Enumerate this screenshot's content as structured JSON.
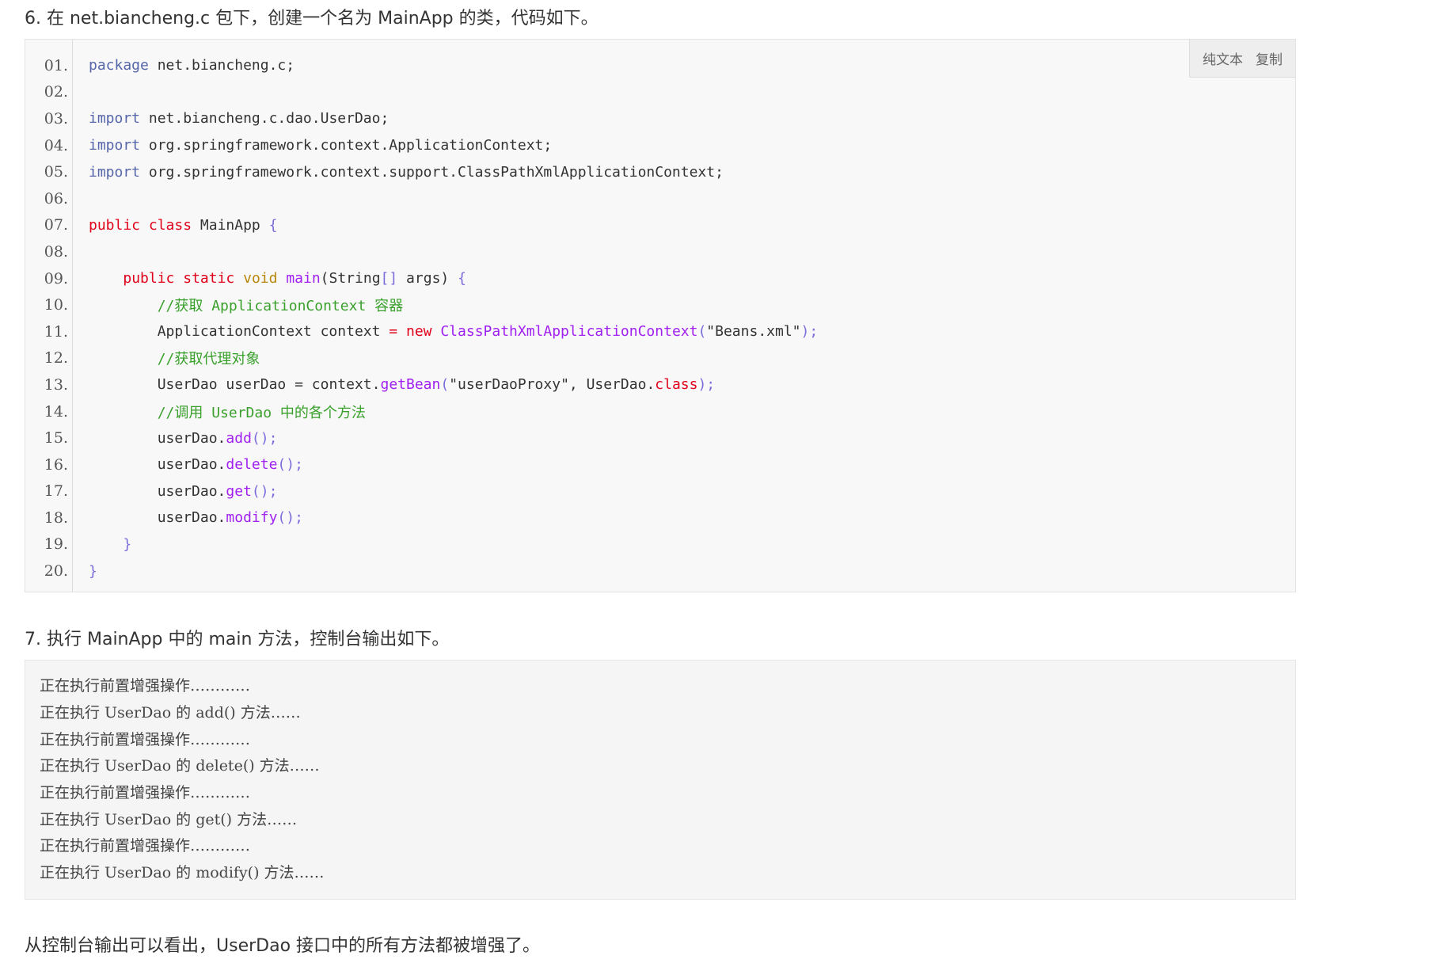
{
  "step6": {
    "heading": "6. 在 net.biancheng.c 包下，创建一个名为 MainApp 的类，代码如下。"
  },
  "toolbar": {
    "plain_text": "纯文本",
    "copy": "复制"
  },
  "code": [
    {
      "num": "01.",
      "text": ""
    },
    {
      "num": "02.",
      "text": ""
    },
    {
      "num": "03.",
      "text": ""
    },
    {
      "num": "04.",
      "text": ""
    },
    {
      "num": "05.",
      "text": ""
    },
    {
      "num": "06.",
      "text": ""
    },
    {
      "num": "07.",
      "text": ""
    },
    {
      "num": "08.",
      "text": ""
    },
    {
      "num": "09.",
      "text": ""
    },
    {
      "num": "10.",
      "text": ""
    },
    {
      "num": "11.",
      "text": ""
    },
    {
      "num": "12.",
      "text": ""
    },
    {
      "num": "13.",
      "text": ""
    },
    {
      "num": "14.",
      "text": ""
    },
    {
      "num": "15.",
      "text": ""
    },
    {
      "num": "16.",
      "text": ""
    },
    {
      "num": "17.",
      "text": ""
    },
    {
      "num": "18.",
      "text": ""
    },
    {
      "num": "19.",
      "text": ""
    },
    {
      "num": "20.",
      "text": ""
    }
  ],
  "tokens": {
    "l1": [
      "package",
      " net.biancheng.c;"
    ],
    "l3": [
      "import",
      " net.biancheng.c.dao.UserDao;"
    ],
    "l4": [
      "import",
      " org.springframework.context.ApplicationContext;"
    ],
    "l5": [
      "import",
      " org.springframework.context.support.ClassPathXmlApplicationContext;"
    ],
    "l7": [
      "public",
      " ",
      "class",
      " MainApp ",
      "{"
    ],
    "l9": [
      "    ",
      "public",
      " ",
      "static",
      " ",
      "void",
      " ",
      "main",
      "(String",
      "[]",
      " args) ",
      "{"
    ],
    "l10": [
      "        ",
      "//获取 ApplicationContext 容器"
    ],
    "l11": [
      "        ApplicationContext context ",
      "=",
      " ",
      "new",
      " ",
      "ClassPathXmlApplicationContext",
      "(",
      "\"Beans.xml\"",
      ");"
    ],
    "l12": [
      "        ",
      "//获取代理对象"
    ],
    "l13": [
      "        UserDao userDao ",
      "=",
      " context.",
      "getBean",
      "(",
      "\"userDaoProxy\"",
      ", UserDao.",
      "class",
      ");"
    ],
    "l14": [
      "        ",
      "//调用 UserDao 中的各个方法"
    ],
    "l15": [
      "        userDao.",
      "add",
      "();"
    ],
    "l16": [
      "        userDao.",
      "delete",
      "();"
    ],
    "l17": [
      "        userDao.",
      "get",
      "();"
    ],
    "l18": [
      "        userDao.",
      "modify",
      "();"
    ],
    "l19": [
      "    ",
      "}"
    ],
    "l20": [
      "",
      "}"
    ]
  },
  "step7": {
    "heading": "7. 执行 MainApp 中的 main 方法，控制台输出如下。"
  },
  "output": [
    "正在执行前置增强操作…………",
    "正在执行 UserDao 的 add() 方法……",
    "正在执行前置增强操作…………",
    "正在执行 UserDao 的 delete() 方法……",
    "正在执行前置增强操作…………",
    "正在执行 UserDao 的 get() 方法……",
    "正在执行前置增强操作…………",
    "正在执行 UserDao 的 modify() 方法……"
  ],
  "conclusion": "从控制台输出可以看出，UserDao 接口中的所有方法都被增强了。"
}
